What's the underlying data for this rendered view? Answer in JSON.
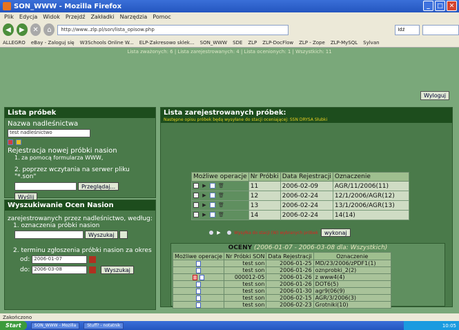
{
  "window": {
    "title": "SON_WWW - Mozilla Firefox"
  },
  "menu": [
    "Plik",
    "Edycja",
    "Widok",
    "Przejdź",
    "Zakładki",
    "Narzędzia",
    "Pomoc"
  ],
  "nav": {
    "url": "http://www..zlp.pl/son/lista_opisow.php",
    "go": "Idź"
  },
  "bookmarks": [
    "ALLEGRO",
    "eBay - Zaloguj się",
    "W3Schools Online W...",
    "ELP-Zakresowo sklek...",
    "SON_WWW",
    "SDE",
    "ZLP",
    "ZLP-DocFlow",
    "ZLP - Zope",
    "ZLP-MySQL",
    "Sylvan"
  ],
  "page": {
    "toplinks": "Lista zważonych: 6 | Lista zarejestrowanych: 4 | Lista ocenionych: 1 | Wszystkich: 11",
    "logout": "Wyloguj",
    "left": {
      "title": "Lista próbek",
      "nadl_label": "Nazwa nadleśnictwa",
      "nadl_value": "test nadleśnictwo",
      "reg_label": "Rejestracja nowej próbki nasion",
      "reg_1": "1. za pomocą formularza WWW,",
      "reg_2": "2. poprzez wczytania na serwer pliku \"*.son\"",
      "browse": "Przeglądaj...",
      "send": "Wyślij",
      "search_title": "Wyszukiwanie Ocen Nasion",
      "search_intro": "zarejestrowanych przez nadleśnictwo, według:",
      "search_1": "1. oznaczenia próbki nasion",
      "search_btn": "Wyszukaj",
      "search_2": "2. terminu zgłoszenia próbki nasion za okres",
      "od_label": "od:",
      "od_value": "2006-01-07",
      "do_label": "do:",
      "do_value": "2006-03-08",
      "search_btn2": "Wyszukaj"
    },
    "right": {
      "title": "Lista zarejestrowanych próbek:",
      "subtitle": "Następne opisu próbek będą wysyłane do stacji oceniającej: SSN DRYSA Słubki",
      "headers": [
        "Możliwe operacje",
        "Nr Próbki",
        "Data Rejestracji",
        "Oznaczenie"
      ],
      "rows": [
        {
          "nr": "11",
          "date": "2006-02-09",
          "ozn": "AGR/11/2006(11)"
        },
        {
          "nr": "12",
          "date": "2006-02-24",
          "ozn": "12/1/2006/AGR(12)"
        },
        {
          "nr": "13",
          "date": "2006-02-24",
          "ozn": "13/1/2006/AGR(13)"
        },
        {
          "nr": "14",
          "date": "2006-02-24",
          "ozn": "14(14)"
        }
      ],
      "pager_text": "Wysyłka do stacji (W) wybranych próbek",
      "execute": "wykonaj",
      "oceny": {
        "title": "OCENY",
        "period": "(2006-01-07 - 2006-03-08 dla: Wszystkich)",
        "headers": [
          "Możliwe operacje",
          "Nr Próbki SON",
          "Data Rejestracji",
          "Oznaczenie"
        ],
        "rows": [
          {
            "nr": "test son",
            "date": "2006-01-25",
            "ozn": "MD/23/2006/zPDF1(1)"
          },
          {
            "nr": "test son",
            "date": "2006-01-26",
            "ozn": "oznprobki_2(2)"
          },
          {
            "nr": "000012-05",
            "date": "2006-01-26",
            "ozn": "z www4(4)"
          },
          {
            "nr": "test son",
            "date": "2006-01-26",
            "ozn": "DOT6(5)"
          },
          {
            "nr": "test son",
            "date": "2006-01-30",
            "ozn": "agr9(06(9)"
          },
          {
            "nr": "test son",
            "date": "2006-02-15",
            "ozn": "AGR/3/2006(3)"
          },
          {
            "nr": "test son",
            "date": "2006-02-23",
            "ozn": "Grotniki(10)"
          }
        ]
      }
    }
  },
  "status": "Zakończono",
  "taskbar": {
    "start": "Start",
    "tasks": [
      "SON_WWW - Mozilla",
      "Stuff? - notatnik"
    ],
    "clock": "10:05"
  }
}
